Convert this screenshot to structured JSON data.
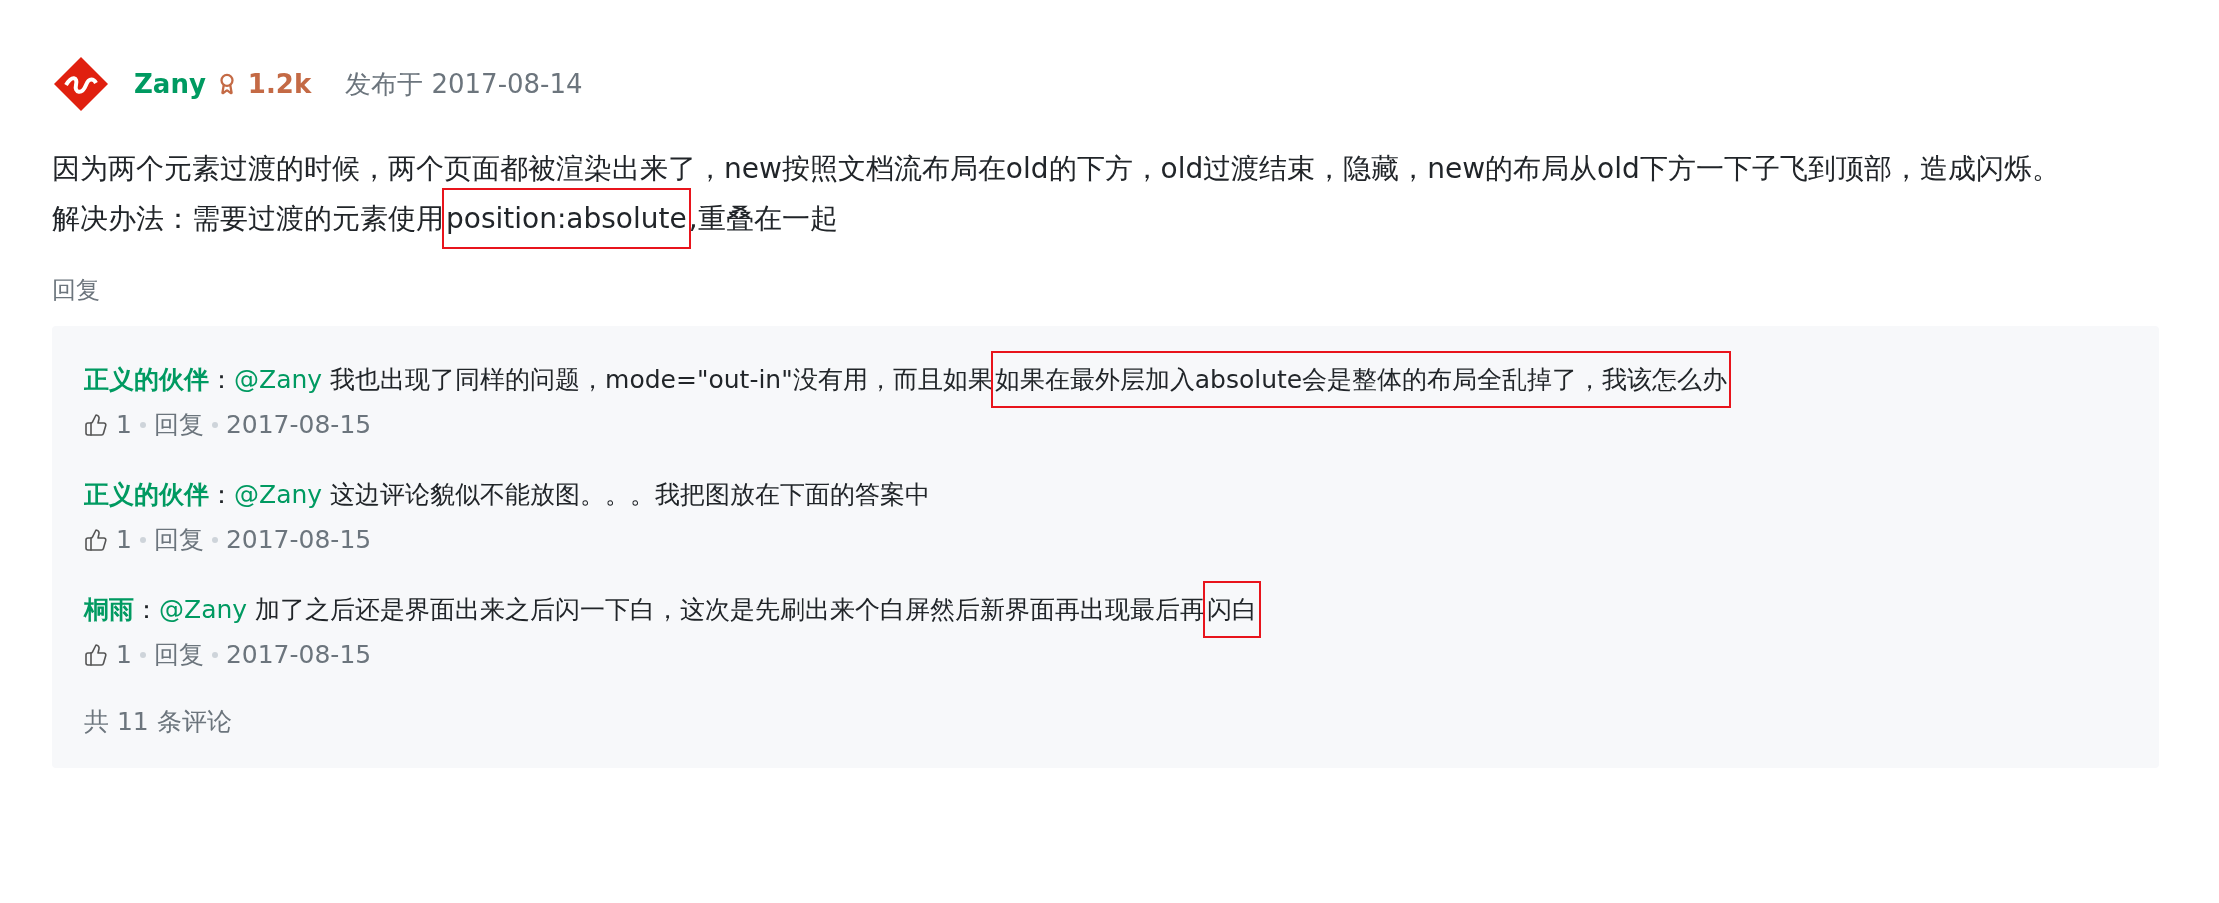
{
  "post": {
    "author": "Zany",
    "reputation": "1.2k",
    "published": "发布于 2017-08-14",
    "body": [
      {
        "segments": [
          {
            "text": "因为两个元素过渡的时候，两个页面都被渲染出来了，new按照文档流布局在old的下方，old过渡结束，隐藏，new的布局从old下方一下子飞到顶部，造成闪烁。",
            "highlight": false
          }
        ]
      },
      {
        "segments": [
          {
            "text": "解决办法：需要过渡的元素使用",
            "highlight": false
          },
          {
            "text": "position:absolute",
            "highlight": true
          },
          {
            "text": ",重叠在一起",
            "highlight": false
          }
        ]
      }
    ],
    "reply_link": "回复"
  },
  "comments": [
    {
      "author": "正义的伙伴",
      "separator": "：",
      "mention": "@Zany",
      "segments": [
        {
          "text": "我也出现了同样的问题，mode=\"out-in\"没有用，而且如果",
          "highlight": false
        },
        {
          "text": "如果在最外层加入absolute会是整体的布局全乱掉了，我该怎么办",
          "highlight": true
        }
      ],
      "likes": "1",
      "reply": "回复",
      "date": "2017-08-15"
    },
    {
      "author": "正义的伙伴",
      "separator": "：",
      "mention": "@Zany",
      "segments": [
        {
          "text": "这边评论貌似不能放图。。。我把图放在下面的答案中",
          "highlight": false
        }
      ],
      "likes": "1",
      "reply": "回复",
      "date": "2017-08-15"
    },
    {
      "author": "桐雨",
      "separator": "：",
      "mention": "@Zany",
      "segments": [
        {
          "text": "加了之后还是界面出来之后闪一下白，这次是先刷出来个白屏然后新界面再出现最后再",
          "highlight": false
        },
        {
          "text": "闪白",
          "highlight": true
        }
      ],
      "likes": "1",
      "reply": "回复",
      "date": "2017-08-15"
    }
  ],
  "total": "共 11 条评论"
}
